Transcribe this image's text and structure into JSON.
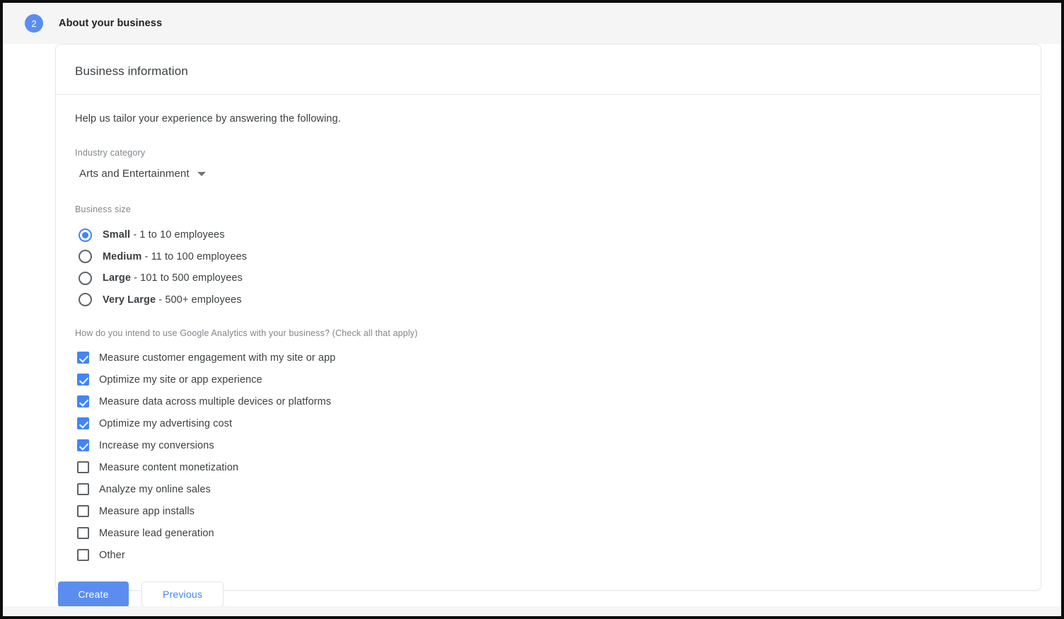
{
  "step": {
    "number": "2",
    "title": "About your business"
  },
  "card": {
    "title": "Business information",
    "intro": "Help us tailor your experience by answering the following.",
    "industry": {
      "label": "Industry category",
      "selected": "Arts and Entertainment"
    },
    "business_size": {
      "label": "Business size",
      "options": [
        {
          "name": "Small",
          "description": " - 1 to 10 employees",
          "selected": true
        },
        {
          "name": "Medium",
          "description": " - 11 to 100 employees",
          "selected": false
        },
        {
          "name": "Large",
          "description": " - 101 to 500 employees",
          "selected": false
        },
        {
          "name": "Very Large",
          "description": " - 500+ employees",
          "selected": false
        }
      ]
    },
    "intent": {
      "question": "How do you intend to use Google Analytics with your business? (Check all that apply)",
      "options": [
        {
          "label": "Measure customer engagement with my site or app",
          "checked": true
        },
        {
          "label": "Optimize my site or app experience",
          "checked": true
        },
        {
          "label": "Measure data across multiple devices or platforms",
          "checked": true
        },
        {
          "label": "Optimize my advertising cost",
          "checked": true
        },
        {
          "label": "Increase my conversions",
          "checked": true
        },
        {
          "label": "Measure content monetization",
          "checked": false
        },
        {
          "label": "Analyze my online sales",
          "checked": false
        },
        {
          "label": "Measure app installs",
          "checked": false
        },
        {
          "label": "Measure lead generation",
          "checked": false
        },
        {
          "label": "Other",
          "checked": false
        }
      ]
    }
  },
  "actions": {
    "create_label": "Create",
    "previous_label": "Previous"
  },
  "colors": {
    "accent": "#4285f4",
    "primary_button": "#5b8def",
    "header_band": "#f5f5f5",
    "text": "#3c4043",
    "muted_text": "#80868b"
  }
}
